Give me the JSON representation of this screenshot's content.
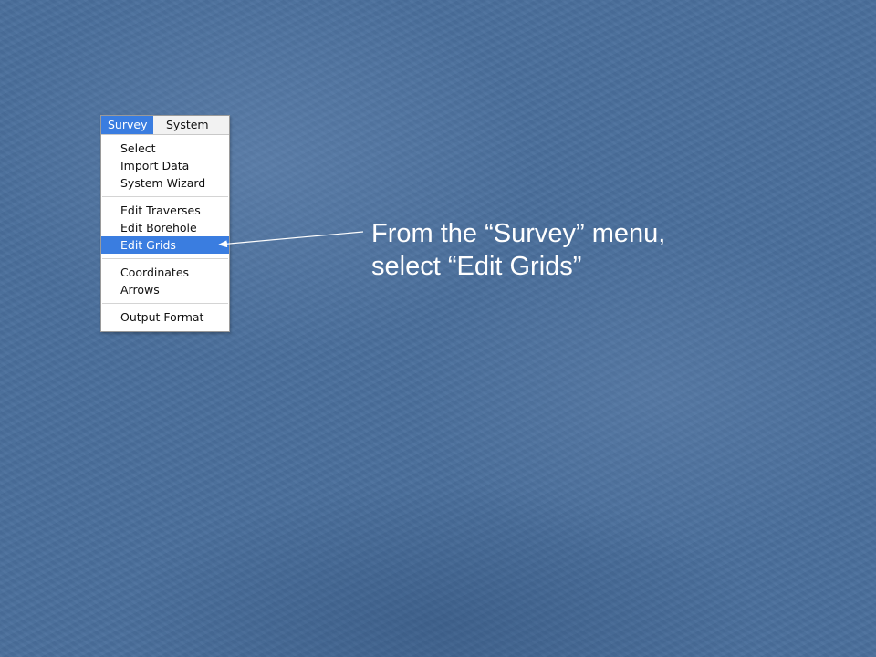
{
  "menubar": {
    "survey_label": "Survey",
    "system_label": "System"
  },
  "menu": {
    "group1": [
      "Select",
      "Import Data",
      "System Wizard"
    ],
    "group2": [
      "Edit Traverses",
      "Edit Borehole",
      "Edit Grids"
    ],
    "group3": [
      "Coordinates",
      "Arrows"
    ],
    "group4": [
      "Output Format"
    ],
    "selected_item": "Edit Grids"
  },
  "callout": {
    "line1": "From the “Survey” menu,",
    "line2": "select “Edit Grids”"
  },
  "colors": {
    "background": "#4a6f9c",
    "highlight": "#3a7de0",
    "callout_text": "#ffffff"
  }
}
